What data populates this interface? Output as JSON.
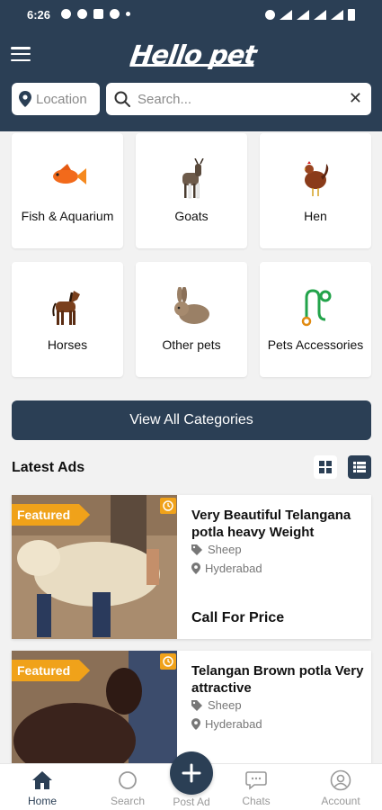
{
  "status_bar": {
    "time": "6:26"
  },
  "header": {
    "logo_text": "Hello pet",
    "location_label": "Location",
    "search_placeholder": "Search..."
  },
  "categories": [
    {
      "label": "Fish & Aquarium",
      "icon": "fish-icon"
    },
    {
      "label": "Goats",
      "icon": "goat-icon"
    },
    {
      "label": "Hen",
      "icon": "hen-icon"
    },
    {
      "label": "Horses",
      "icon": "horse-icon"
    },
    {
      "label": "Other pets",
      "icon": "rabbit-icon"
    },
    {
      "label": "Pets Accessories",
      "icon": "leash-icon"
    }
  ],
  "view_all_label": "View All Categories",
  "latest": {
    "title": "Latest Ads",
    "ads": [
      {
        "badge": "Featured",
        "title": "Very Beautiful Telangana potla heavy Weight",
        "category": "Sheep",
        "location": "Hyderabad",
        "price": "Call For Price"
      },
      {
        "badge": "Featured",
        "title": "Telangan Brown potla Very attractive",
        "category": "Sheep",
        "location": "Hyderabad"
      }
    ]
  },
  "bottom_nav": {
    "home": "Home",
    "search": "Search",
    "post_ad": "Post Ad",
    "chats": "Chats",
    "account": "Account"
  },
  "colors": {
    "primary": "#2b3f55",
    "featured": "#f0a21a"
  }
}
